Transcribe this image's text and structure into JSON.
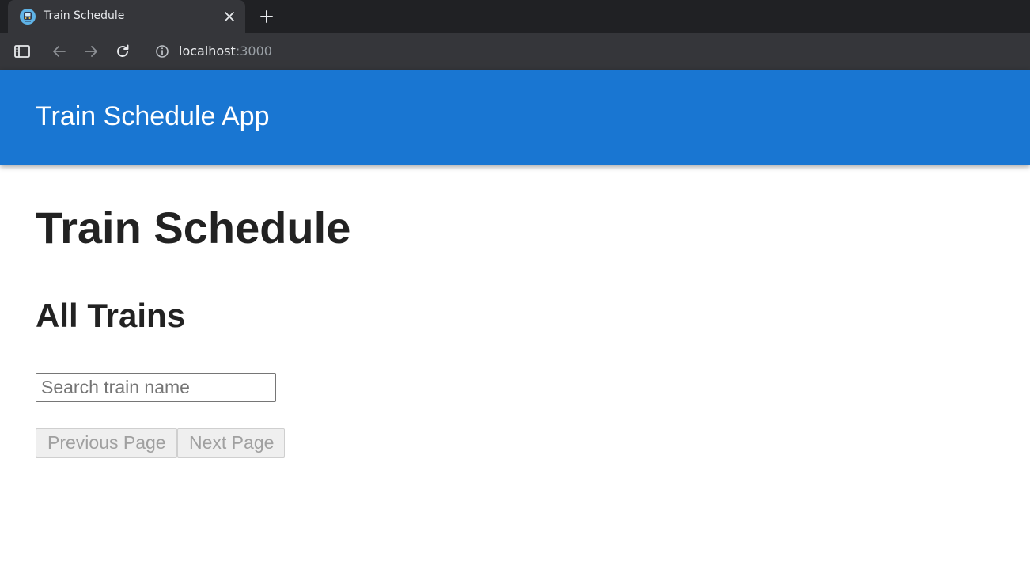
{
  "browser": {
    "tab": {
      "title": "Train Schedule"
    },
    "address": {
      "host": "localhost",
      "port": ":3000"
    },
    "icons": [
      "train-favicon",
      "close-icon",
      "plus-icon",
      "sidebar-icon",
      "back-arrow-icon",
      "forward-arrow-icon",
      "reload-icon",
      "info-icon"
    ]
  },
  "app": {
    "title": "Train Schedule App",
    "accent_color": "#1976d2"
  },
  "page": {
    "title": "Train Schedule",
    "section_title": "All Trains",
    "search": {
      "placeholder": "Search train name",
      "value": ""
    },
    "pagination": {
      "prev_label": "Previous Page",
      "next_label": "Next Page",
      "prev_disabled": true,
      "next_disabled": true
    }
  }
}
